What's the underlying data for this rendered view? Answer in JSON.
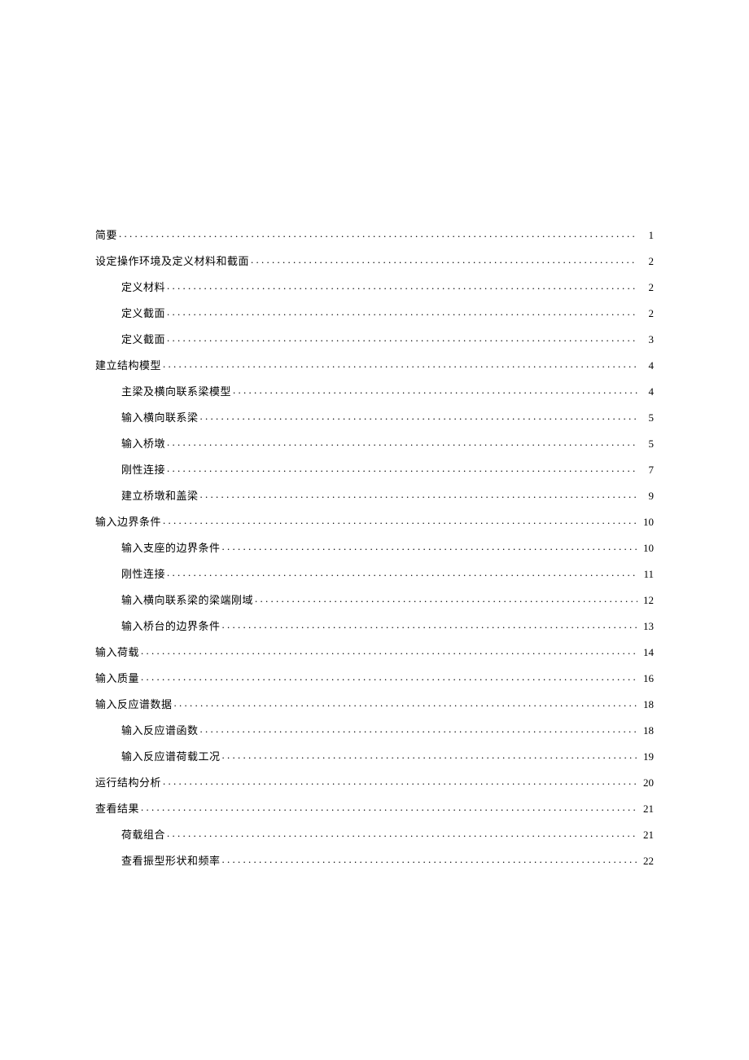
{
  "toc": [
    {
      "title": "简要",
      "page": "1",
      "level": 0
    },
    {
      "title": "设定操作环境及定义材料和截面",
      "page": "2",
      "level": 0
    },
    {
      "title": "定义材料",
      "page": "2",
      "level": 1
    },
    {
      "title": "定义截面",
      "page": "2",
      "level": 1
    },
    {
      "title": "定义截面",
      "page": "3",
      "level": 1
    },
    {
      "title": "建立结构模型",
      "page": "4",
      "level": 0
    },
    {
      "title": "主梁及横向联系梁模型",
      "page": "4",
      "level": 1
    },
    {
      "title": "输入横向联系梁",
      "page": "5",
      "level": 1
    },
    {
      "title": "输入桥墩",
      "page": "5",
      "level": 1
    },
    {
      "title": "刚性连接",
      "page": "7",
      "level": 1
    },
    {
      "title": "建立桥墩和盖梁",
      "page": "9",
      "level": 1
    },
    {
      "title": "输入边界条件",
      "page": "10",
      "level": 0
    },
    {
      "title": "输入支座的边界条件",
      "page": "10",
      "level": 1
    },
    {
      "title": "刚性连接",
      "page": "11",
      "level": 1
    },
    {
      "title": "输入横向联系梁的梁端刚域",
      "page": "12",
      "level": 1
    },
    {
      "title": "输入桥台的边界条件",
      "page": "13",
      "level": 1
    },
    {
      "title": "输入荷载",
      "page": "14",
      "level": 0
    },
    {
      "title": "输入质量",
      "page": "16",
      "level": 0
    },
    {
      "title": "输入反应谱数据",
      "page": "18",
      "level": 0
    },
    {
      "title": "输入反应谱函数",
      "page": "18",
      "level": 1
    },
    {
      "title": "输入反应谱荷载工况",
      "page": "19",
      "level": 1
    },
    {
      "title": "运行结构分析",
      "page": "20",
      "level": 0
    },
    {
      "title": "查看结果",
      "page": "21",
      "level": 0
    },
    {
      "title": "荷载组合",
      "page": "21",
      "level": 1
    },
    {
      "title": "查看振型形状和频率",
      "page": "22",
      "level": 1
    }
  ]
}
